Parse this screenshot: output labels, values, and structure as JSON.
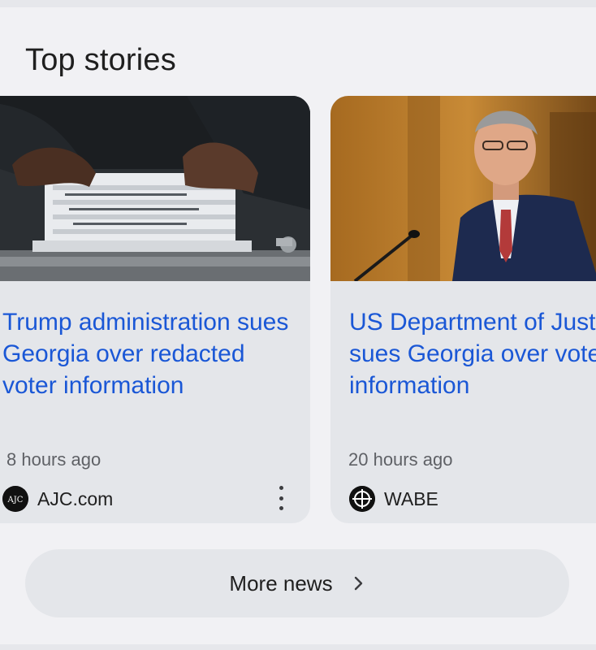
{
  "section": {
    "title": "Top stories"
  },
  "stories": [
    {
      "headline": "Trump administration sues Georgia over redacted voter information",
      "time": "8 hours ago",
      "source": "AJC.com",
      "source_logo_text": "AJC",
      "image_icon": "ballots-photo"
    },
    {
      "headline": "US Department of Justice sues Georgia over voter information",
      "time": "20 hours ago",
      "source": "WABE",
      "image_icon": "official-at-podium-photo"
    }
  ],
  "more_news": {
    "label": "More news",
    "icon": "chevron-right-icon"
  },
  "colors": {
    "headline": "#1a57d6",
    "card_background": "#e4e6ea",
    "panel_background": "#f1f1f4"
  }
}
